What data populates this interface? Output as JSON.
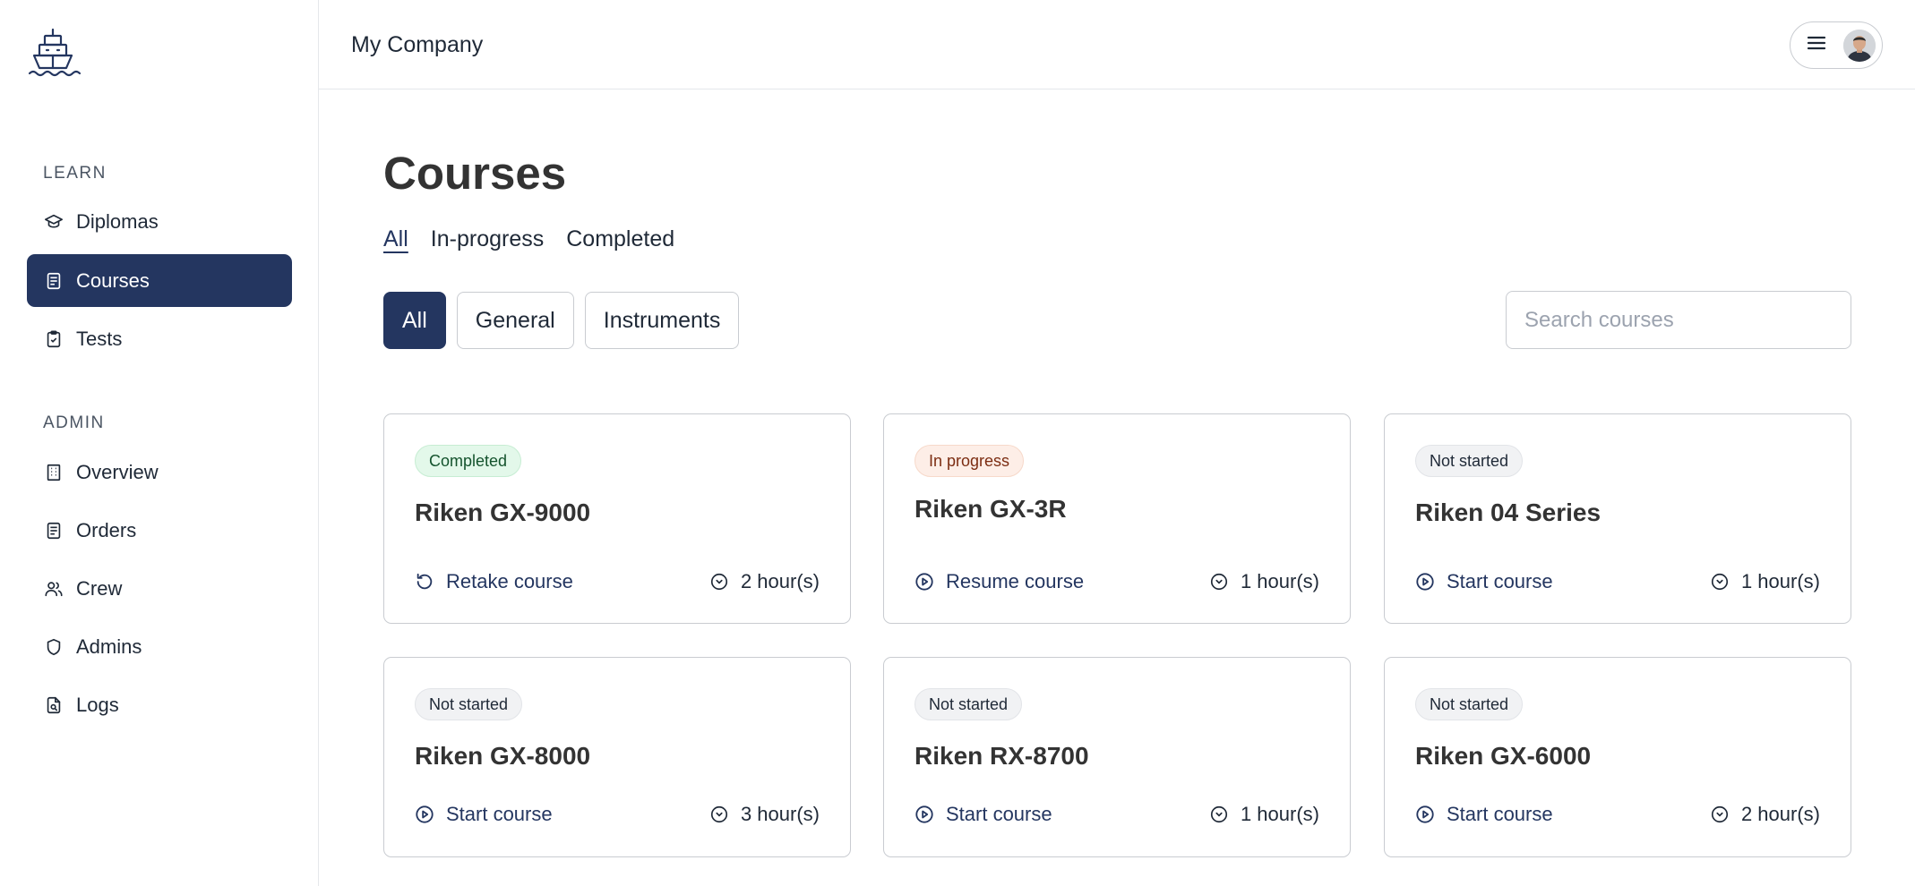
{
  "app": {
    "company": "My Company"
  },
  "sidebar": {
    "learn_label": "LEARN",
    "admin_label": "ADMIN",
    "learn_items": [
      {
        "label": "Diplomas",
        "icon": "graduation-cap-icon"
      },
      {
        "label": "Courses",
        "icon": "document-icon",
        "active": true
      },
      {
        "label": "Tests",
        "icon": "clipboard-check-icon"
      }
    ],
    "admin_items": [
      {
        "label": "Overview",
        "icon": "building-icon"
      },
      {
        "label": "Orders",
        "icon": "document-icon"
      },
      {
        "label": "Crew",
        "icon": "users-icon"
      },
      {
        "label": "Admins",
        "icon": "shield-icon"
      },
      {
        "label": "Logs",
        "icon": "file-search-icon"
      }
    ]
  },
  "main": {
    "title": "Courses",
    "tabs": [
      {
        "label": "All",
        "active": true
      },
      {
        "label": "In-progress"
      },
      {
        "label": "Completed"
      }
    ],
    "filters": [
      {
        "label": "All",
        "active": true
      },
      {
        "label": "General"
      },
      {
        "label": "Instruments"
      }
    ],
    "search": {
      "placeholder": "Search courses",
      "value": ""
    }
  },
  "courses": [
    {
      "status": "Completed",
      "title": "Riken GX-9000",
      "action": "Retake course",
      "action_icon": "retake-icon",
      "duration": "2 hour(s)"
    },
    {
      "status": "In progress",
      "title": "Riken GX-3R",
      "action": "Resume course",
      "action_icon": "play-circle-icon",
      "duration": "1 hour(s)"
    },
    {
      "status": "Not started",
      "title": "Riken 04 Series",
      "action": "Start course",
      "action_icon": "play-circle-icon",
      "duration": "1 hour(s)"
    },
    {
      "status": "Not started",
      "title": "Riken GX-8000",
      "action": "Start course",
      "action_icon": "play-circle-icon",
      "duration": "3 hour(s)"
    },
    {
      "status": "Not started",
      "title": "Riken RX-8700",
      "action": "Start course",
      "action_icon": "play-circle-icon",
      "duration": "1 hour(s)"
    },
    {
      "status": "Not started",
      "title": "Riken GX-6000",
      "action": "Start course",
      "action_icon": "play-circle-icon",
      "duration": "2 hour(s)"
    }
  ],
  "colors": {
    "accent": "#243660",
    "completed_bg": "#e3f8ea",
    "in_progress_bg": "#fdeee7",
    "not_started_bg": "#f1f2f4"
  }
}
